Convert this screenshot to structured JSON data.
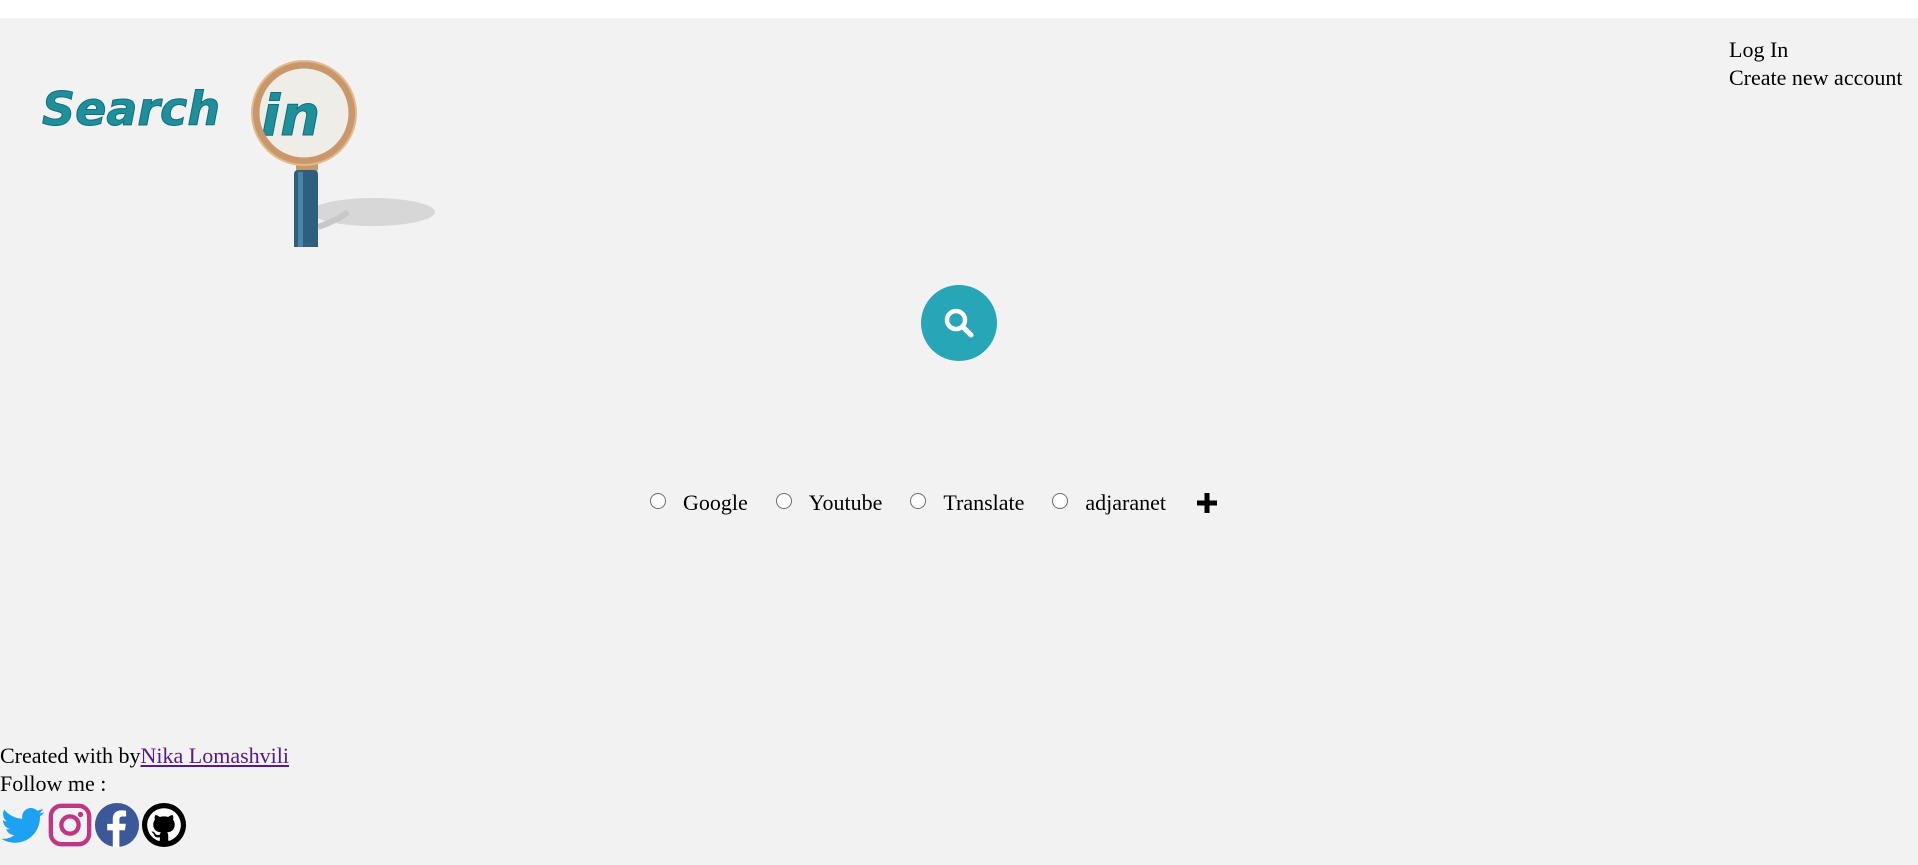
{
  "logo": {
    "word1": "Search",
    "word2": "in",
    "icon": "magnifying-glass-logo"
  },
  "auth": {
    "login_label": "Log In",
    "signup_label": "Create new account"
  },
  "search": {
    "icon": "search-icon",
    "color": "#26a6b7"
  },
  "engines": [
    {
      "label": "Google",
      "selected": false
    },
    {
      "label": "Youtube",
      "selected": false
    },
    {
      "label": "Translate",
      "selected": false
    },
    {
      "label": "adjaranet",
      "selected": false
    }
  ],
  "add_engine": {
    "icon": "plus-icon"
  },
  "footer": {
    "created_prefix": "Created with by",
    "author_name": "Nika Lomashvili",
    "follow_label": "Follow me :",
    "socials": [
      {
        "icon": "twitter-icon",
        "color": "#1da1f2"
      },
      {
        "icon": "instagram-icon",
        "color": "#c13584"
      },
      {
        "icon": "facebook-icon",
        "color": "#3b5998"
      },
      {
        "icon": "github-icon",
        "color": "#000000"
      }
    ]
  }
}
